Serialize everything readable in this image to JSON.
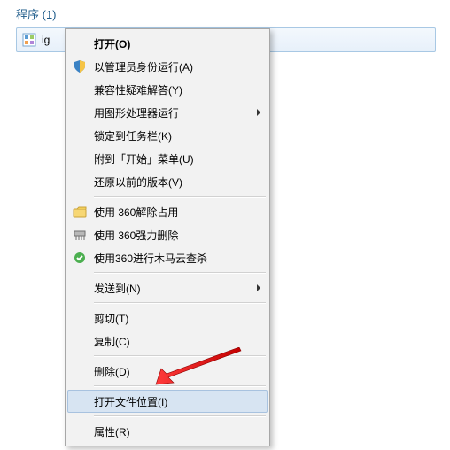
{
  "header": {
    "title": "程序 (1)"
  },
  "result": {
    "name_prefix": "ig"
  },
  "menu": {
    "open": "打开(O)",
    "run_as_admin": "以管理员身份运行(A)",
    "troubleshoot": "兼容性疑难解答(Y)",
    "run_with_gpu": "用图形处理器运行",
    "pin_taskbar": "锁定到任务栏(K)",
    "pin_start": "附到「开始」菜单(U)",
    "restore_prev": "还原以前的版本(V)",
    "use_360_unlock": "使用 360解除占用",
    "use_360_force_delete": "使用 360强力删除",
    "use_360_scan": "使用360进行木马云查杀",
    "send_to": "发送到(N)",
    "cut": "剪切(T)",
    "copy": "复制(C)",
    "delete": "删除(D)",
    "open_file_location": "打开文件位置(I)",
    "properties": "属性(R)"
  }
}
